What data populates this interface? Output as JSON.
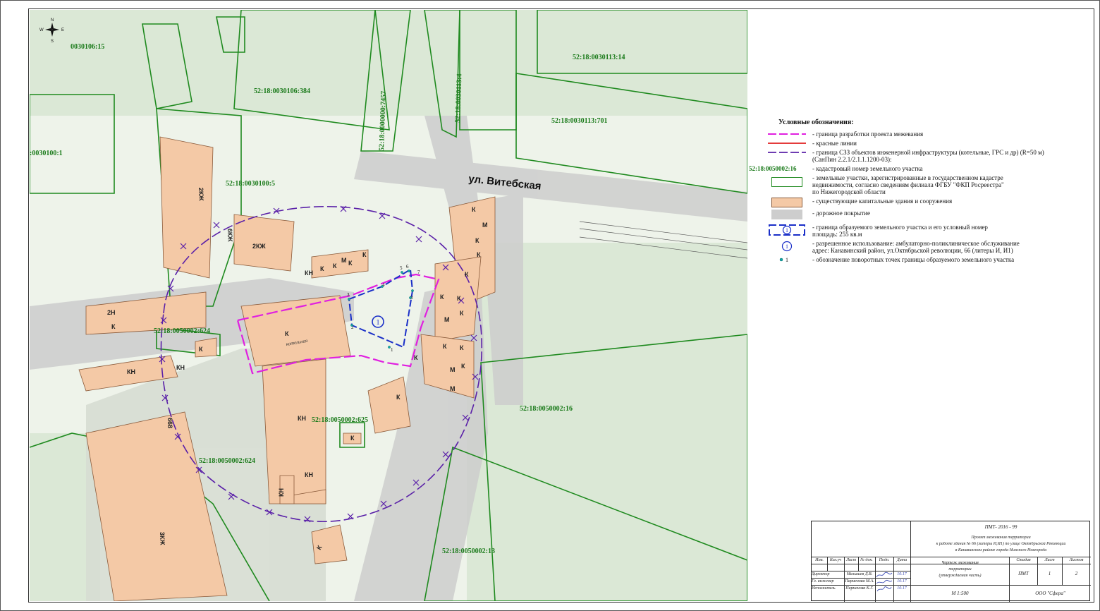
{
  "map": {
    "compass": {
      "n": "N",
      "s": "S",
      "w": "W",
      "e": "E"
    },
    "street": "ул. Витебская",
    "cadastral_labels": [
      "0030106:15",
      "52:18:0030106:384",
      "52:18:0000000:7457",
      "52:18:0030113:4",
      "52:18:0030113:14",
      "52:18:0030113:701",
      ":0030100:1",
      "52:18:0030100:5",
      "52:18:0050002:624",
      "52:18:0050002:625",
      "52:18:0050002:624",
      "52:18:0050002:16",
      "52:18:0050002:13"
    ],
    "buildings": [
      "2КЖ",
      "2КЖ",
      "К",
      "К",
      "К",
      "М",
      "К",
      "КН",
      "К",
      "К",
      "М",
      "К",
      "К",
      "К",
      "К",
      "М",
      "К",
      "К",
      "М",
      "К",
      "К",
      "К",
      "К",
      "М",
      "К",
      "2Н",
      "К",
      "КН",
      "КН",
      "КН",
      "КН",
      "КН",
      "3КЖ",
      "К",
      "К",
      "К",
      "6КЖ",
      "668"
    ],
    "parcel_number": "1",
    "point_labels": [
      "1",
      "2",
      "3",
      "4",
      "5",
      "6",
      "7",
      "8"
    ],
    "building_notes": [
      "котельная"
    ]
  },
  "legend": {
    "title": "Условные обозначения:",
    "items": [
      {
        "text": "- граница разработки проекта межевания"
      },
      {
        "text": "- красные линии"
      },
      {
        "text": "- граница СЗЗ объектов инженерной инфраструктуры (котельные, ГРС и др) (R=50 м)",
        "text2": "(СанПин 2.2.1/2.1.1.1200-03):"
      },
      {
        "symbol_text": "52:18:0050002:16",
        "text": "- кадастровый номер земельного участка"
      },
      {
        "text": "- земельные участки, зарегистрированные в государственном кадастре",
        "text2": "недвижимости, согласно сведениям филиала ФГБУ \"ФКП Росреестра\"",
        "text3": "по Нижегородской области"
      },
      {
        "text": "- существующие капитальные здания и сооружения"
      },
      {
        "text": "- дорожное покрытие"
      },
      {
        "symbol_text": "1",
        "text": "- граница образуемого земельного участка и его условный номер",
        "text2": "площадь: 255 кв.м"
      },
      {
        "symbol_text": "1",
        "text": "- разрешенное использование: амбулаторно-поликлиническое обслуживание",
        "text2": "адрес: Канавинский район, ул.Октябрьской революции, 66 (литеры И, И1)"
      },
      {
        "symbol_text": "1",
        "text": "- обозначение поворотных точек границы образуемого земельного участка"
      }
    ]
  },
  "stamp": {
    "code": "ПМТ- 2016 - 99",
    "project_title_1": "Проект межевания территории",
    "project_title_2": "к работе здания № 66 (литеры И,И1) по улице Октябрьской Революции",
    "project_title_3": "в Канавинском районе города Нижнего Новгорода",
    "headers": [
      "Изм.",
      "Кол.уч",
      "Лист",
      "№ док.",
      "Подп.",
      "Дата"
    ],
    "roles": [
      "Директор",
      "Гл. инженер",
      "Исполнитель"
    ],
    "names": [
      "Малышев Д.В.",
      "Парменова М.А.",
      "Парменова К.Г."
    ],
    "dates": [
      "10.17",
      "10.17",
      "10.17"
    ],
    "sheet_title_1": "Чертеж межевания",
    "sheet_title_2": "территории",
    "sheet_title_3": "(утверждаемая часть)",
    "stage_header": "Стадия",
    "sheet_header": "Лист",
    "sheets_header": "Листов",
    "stage": "ПМТ",
    "sheet": "1",
    "sheets": "2",
    "scale": "М 1:500",
    "org": "ООО \"Сфера\""
  },
  "colors": {
    "parcel_green": "#1f8a1f",
    "building_fill": "#f4c9a6",
    "building_stroke": "#8a5a3a",
    "road": "#cfcfcf",
    "project_boundary": "#e020e0",
    "sanitary_zone": "#5a20a8",
    "new_parcel": "#1a2fc8",
    "red_line": "#e02020"
  }
}
